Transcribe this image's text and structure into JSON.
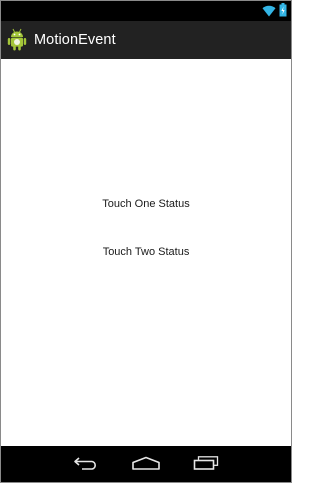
{
  "app": {
    "title": "MotionEvent",
    "icon": "android-robot-icon"
  },
  "status_bar": {
    "icons": [
      "wifi-icon",
      "battery-icon"
    ]
  },
  "content": {
    "touch_one_status": "Touch One Status",
    "touch_two_status": "Touch Two Status"
  },
  "nav_bar": {
    "buttons": [
      "back-icon",
      "home-icon",
      "recent-apps-icon"
    ]
  },
  "colors": {
    "action_bar": "#222222",
    "status_bar": "#000000",
    "nav_bar": "#000000",
    "system_icon": "#33b5e5"
  }
}
